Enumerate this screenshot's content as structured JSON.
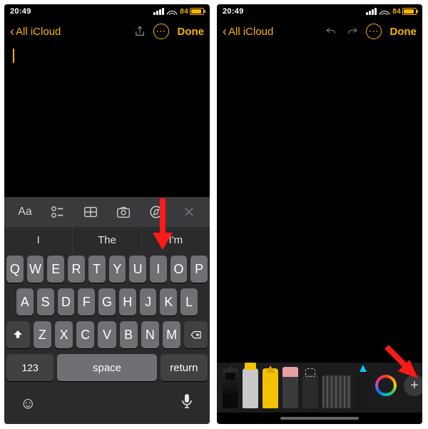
{
  "status": {
    "time": "20:49",
    "battery_pct": "84"
  },
  "nav": {
    "back_label": "All iCloud",
    "done_label": "Done"
  },
  "format_row": {
    "text_format": "Aa",
    "close": "✕"
  },
  "suggestions": [
    "I",
    "The",
    "I'm"
  ],
  "keyboard": {
    "row1": [
      "Q",
      "W",
      "E",
      "R",
      "T",
      "Y",
      "U",
      "I",
      "O",
      "P"
    ],
    "row2": [
      "A",
      "S",
      "D",
      "F",
      "G",
      "H",
      "J",
      "K",
      "L"
    ],
    "row3": [
      "Z",
      "X",
      "C",
      "V",
      "B",
      "N",
      "M"
    ],
    "num": "123",
    "space": "space",
    "ret": "return"
  },
  "drawbar": {
    "add": "+"
  }
}
